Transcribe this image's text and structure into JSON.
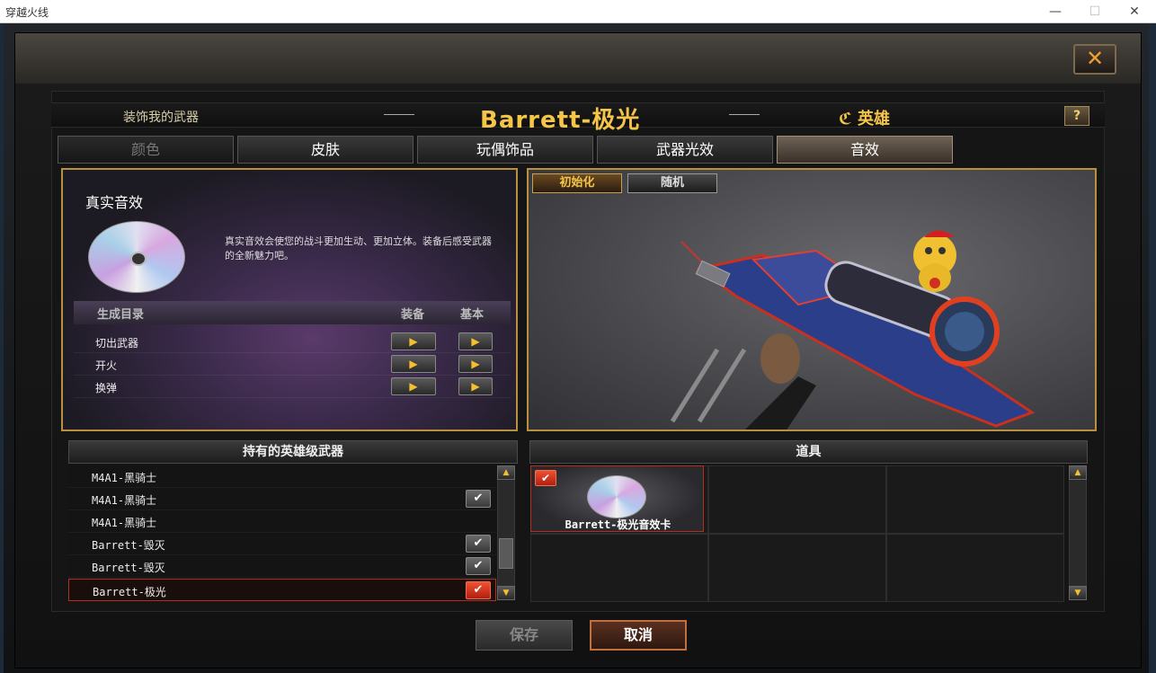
{
  "window": {
    "title": "穿越火线",
    "minimize": "—",
    "maximize": "☐",
    "close": "✕"
  },
  "dialog": {
    "close_glyph": "✕",
    "subtitle": "装饰我的武器",
    "title": "Barrett-极光",
    "dash": "—",
    "hero_label": "英雄",
    "hero_glyph": "ℭ",
    "help": "?"
  },
  "tabs": [
    {
      "label": "颜色",
      "state": "disabled"
    },
    {
      "label": "皮肤",
      "state": "normal"
    },
    {
      "label": "玩偶饰品",
      "state": "normal"
    },
    {
      "label": "武器光效",
      "state": "normal"
    },
    {
      "label": "音效",
      "state": "active"
    }
  ],
  "sound": {
    "title": "真实音效",
    "description": "真实音效会使您的战斗更加生动、更加立体。装备后感受武器的全新魅力吧。",
    "columns": {
      "category": "生成目录",
      "equip": "装备",
      "basic": "基本"
    },
    "rows": [
      {
        "label": "切出武器"
      },
      {
        "label": "开火"
      },
      {
        "label": "换弹"
      }
    ],
    "play_glyph": "▶"
  },
  "preview": {
    "init_label": "初始化",
    "random_label": "随机"
  },
  "weapons": {
    "header": "持有的英雄级武器",
    "items": [
      {
        "name": "M4A1-黑骑士",
        "checked": false,
        "selected": false
      },
      {
        "name": "M4A1-黑骑士",
        "checked": true,
        "selected": false
      },
      {
        "name": "M4A1-黑骑士",
        "checked": false,
        "selected": false
      },
      {
        "name": "Barrett-毁灭",
        "checked": true,
        "selected": false
      },
      {
        "name": "Barrett-毁灭",
        "checked": true,
        "selected": false
      },
      {
        "name": "Barrett-极光",
        "checked": true,
        "selected": true
      }
    ],
    "check_glyph": "✔"
  },
  "items": {
    "header": "道具",
    "card_name": "Barrett-极光音效卡",
    "check_glyph": "✔"
  },
  "scroll": {
    "up": "▲",
    "down": "▼"
  },
  "buttons": {
    "save": "保存",
    "cancel": "取消"
  },
  "colors": {
    "accent_gold": "#f4c548",
    "frame_gold": "#b89040",
    "selected_red": "#b03020"
  }
}
